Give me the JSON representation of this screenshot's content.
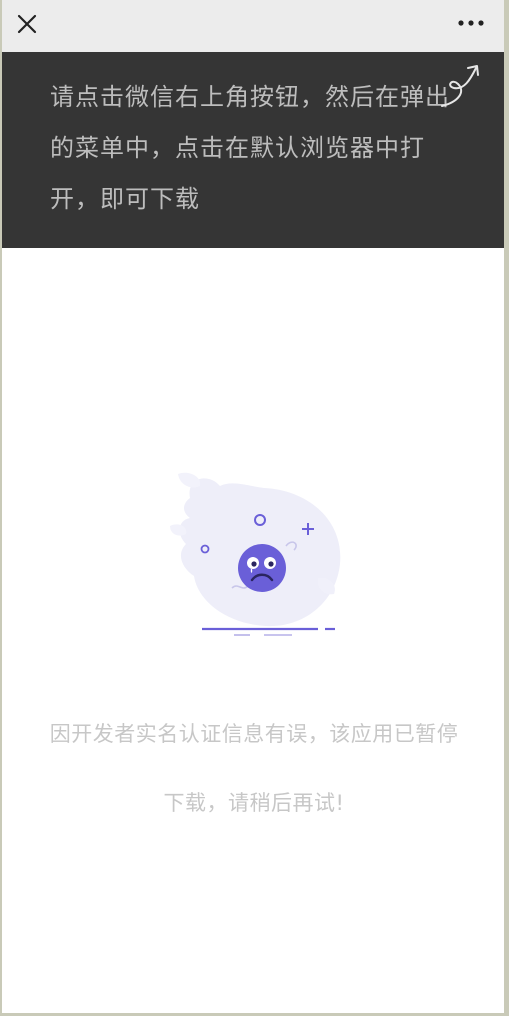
{
  "topbar": {
    "close_icon": "close-icon",
    "more_icon": "more-icon"
  },
  "overlay": {
    "instruction": "请点击微信右上角按钮，然后在弹出的菜单中，点击在默认浏览器中打开，即可下载",
    "arrow_icon": "curved-arrow-icon"
  },
  "main": {
    "illustration_icon": "sad-face-icon",
    "message": "因开发者实名认证信息有误，该应用已暂停下载，请稍后再试!"
  },
  "colors": {
    "overlay_bg": "#353535",
    "accent": "#6a5fd8",
    "illustration_bg": "#eeeef9"
  }
}
